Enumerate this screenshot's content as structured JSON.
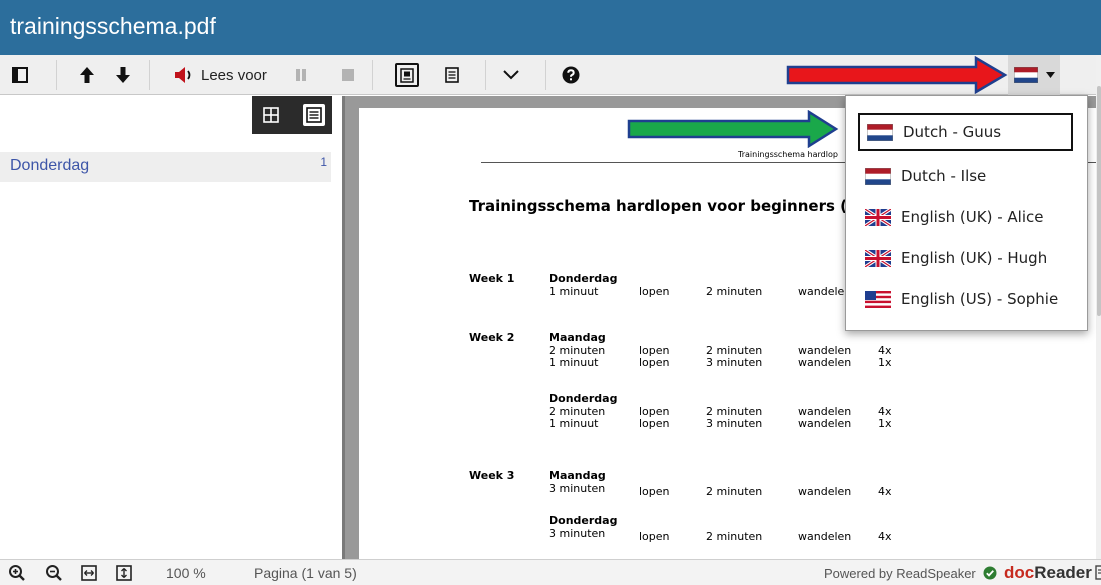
{
  "window": {
    "title": "trainingsschema.pdf"
  },
  "toolbar": {
    "sidebar_toggle_icon": "sidebar-icon",
    "prev_icon": "arrow-up-icon",
    "next_icon": "arrow-down-icon",
    "read_aloud_label": "Lees voor",
    "read_aloud_icon": "speaker-icon",
    "pause_icon": "pause-icon",
    "stop_icon": "stop-icon",
    "single_page_icon": "page-view-icon",
    "text_view_icon": "text-view-icon",
    "more_icon": "chevron-down-icon",
    "help_icon": "help-icon",
    "language_icon": "flag-nl-icon"
  },
  "sidebar": {
    "view_buttons": [
      "thumbnails-icon",
      "outline-icon"
    ],
    "items": [
      {
        "label": "Donderdag",
        "page": "1"
      }
    ]
  },
  "document": {
    "running_header": "Trainingsschema hardlop",
    "heading": "Trainingsschema hardlopen voor beginners (",
    "weeks": [
      {
        "label": "Week 1",
        "days": [
          {
            "name": "Donderdag",
            "rows": [
              [
                "1 minuut",
                "lopen",
                "2 minuten",
                "wandele",
                ""
              ]
            ]
          }
        ]
      },
      {
        "label": "Week 2",
        "days": [
          {
            "name": "Maandag",
            "rows": [
              [
                "2 minuten",
                "lopen",
                "2 minuten",
                "wandelen",
                "4x"
              ],
              [
                "1 minuut",
                "lopen",
                "3 minuten",
                "wandelen",
                "1x"
              ]
            ]
          },
          {
            "name": "Donderdag",
            "rows": [
              [
                "2 minuten",
                "lopen",
                "2 minuten",
                "wandelen",
                "4x"
              ],
              [
                "1 minuut",
                "lopen",
                "3 minuten",
                "wandelen",
                "1x"
              ]
            ]
          }
        ]
      },
      {
        "label": "Week 3",
        "days": [
          {
            "name": "Maandag",
            "rows": [
              [
                "3 minuten",
                "lopen",
                "2 minuten",
                "wandelen",
                "4x"
              ]
            ]
          },
          {
            "name": "Donderdag",
            "rows": [
              [
                "3 minuten",
                "lopen",
                "2 minuten",
                "wandelen",
                "4x"
              ]
            ]
          }
        ]
      }
    ]
  },
  "language_menu": {
    "items": [
      {
        "label": "Dutch - Guus",
        "flag": "flag-nl-icon",
        "selected": true
      },
      {
        "label": "Dutch - Ilse",
        "flag": "flag-nl-icon",
        "selected": false
      },
      {
        "label": "English (UK) - Alice",
        "flag": "flag-uk-icon",
        "selected": false
      },
      {
        "label": "English (UK) - Hugh",
        "flag": "flag-uk-icon",
        "selected": false
      },
      {
        "label": "English (US) - Sophie",
        "flag": "flag-us-icon",
        "selected": false
      }
    ]
  },
  "annotations": {
    "red_arrow_color": "#e8161b",
    "green_arrow_color": "#1aa84a",
    "arrow_outline_color": "#1f3f8f"
  },
  "bottombar": {
    "zoom_in_icon": "zoom-in-icon",
    "zoom_out_icon": "zoom-out-icon",
    "fit_width_icon": "fit-width-icon",
    "fit_height_icon": "fit-height-icon",
    "zoom": "100 %",
    "page_info": "Pagina (1 van 5)",
    "powered_by": "Powered by ReadSpeaker",
    "brand_prefix": "doc",
    "brand_suffix": "Reader"
  },
  "colors": {
    "titlebar": "#2c6e9c",
    "toc_link": "#3d55a8",
    "brand_red": "#c62a1f",
    "check_green": "#2e7d32"
  }
}
